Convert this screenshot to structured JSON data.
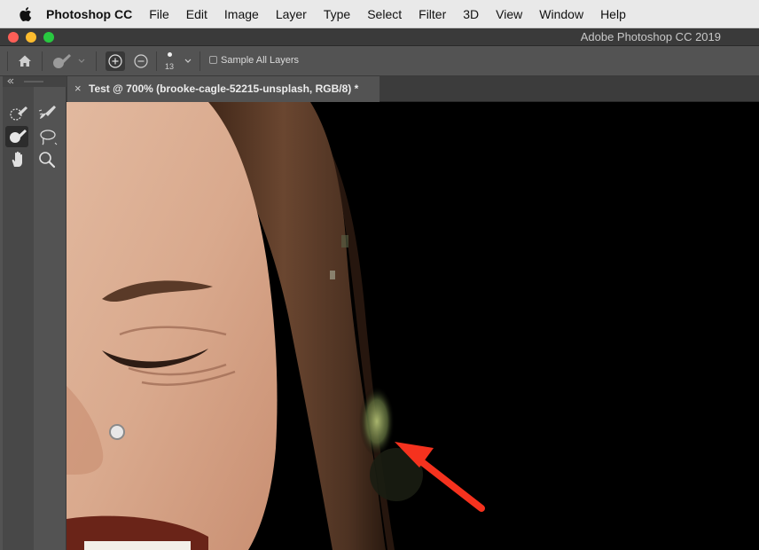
{
  "menubar": {
    "apple_icon": "apple-logo",
    "app_name": "Photoshop CC",
    "items": [
      "File",
      "Edit",
      "Image",
      "Layer",
      "Type",
      "Select",
      "Filter",
      "3D",
      "View",
      "Window",
      "Help"
    ]
  },
  "window": {
    "title": "Adobe Photoshop CC 2019",
    "controls": {
      "close_color": "#fe5f57",
      "minimize_color": "#febc2e",
      "zoom_color": "#28c840"
    }
  },
  "options_bar": {
    "home_icon": "home-icon",
    "tool_preset_icon": "quick-selection-brush-icon",
    "new_selection_icon": "add-to-selection-icon",
    "subtract_icon": "subtract-from-selection-icon",
    "brush_size": "13",
    "sample_all_layers_label": "Sample All Layers",
    "sample_all_layers_checked": false
  },
  "toolbar": {
    "tools": [
      {
        "name": "quick-selection-tool",
        "icon": "quick-selection-icon"
      },
      {
        "name": "refine-edge-brush-tool",
        "icon": "refine-edge-brush-icon"
      },
      {
        "name": "brush-tool",
        "icon": "brush-icon",
        "active": true
      },
      {
        "name": "lasso-tool",
        "icon": "lasso-icon"
      },
      {
        "name": "hand-tool",
        "icon": "hand-icon"
      },
      {
        "name": "zoom-tool",
        "icon": "zoom-icon"
      }
    ]
  },
  "document_tab": {
    "close_glyph": "×",
    "label": "Test @ 700% (brooke-cagle-52215-unsplash, RGB/8) *"
  },
  "canvas": {
    "annotation": "red-arrow"
  }
}
